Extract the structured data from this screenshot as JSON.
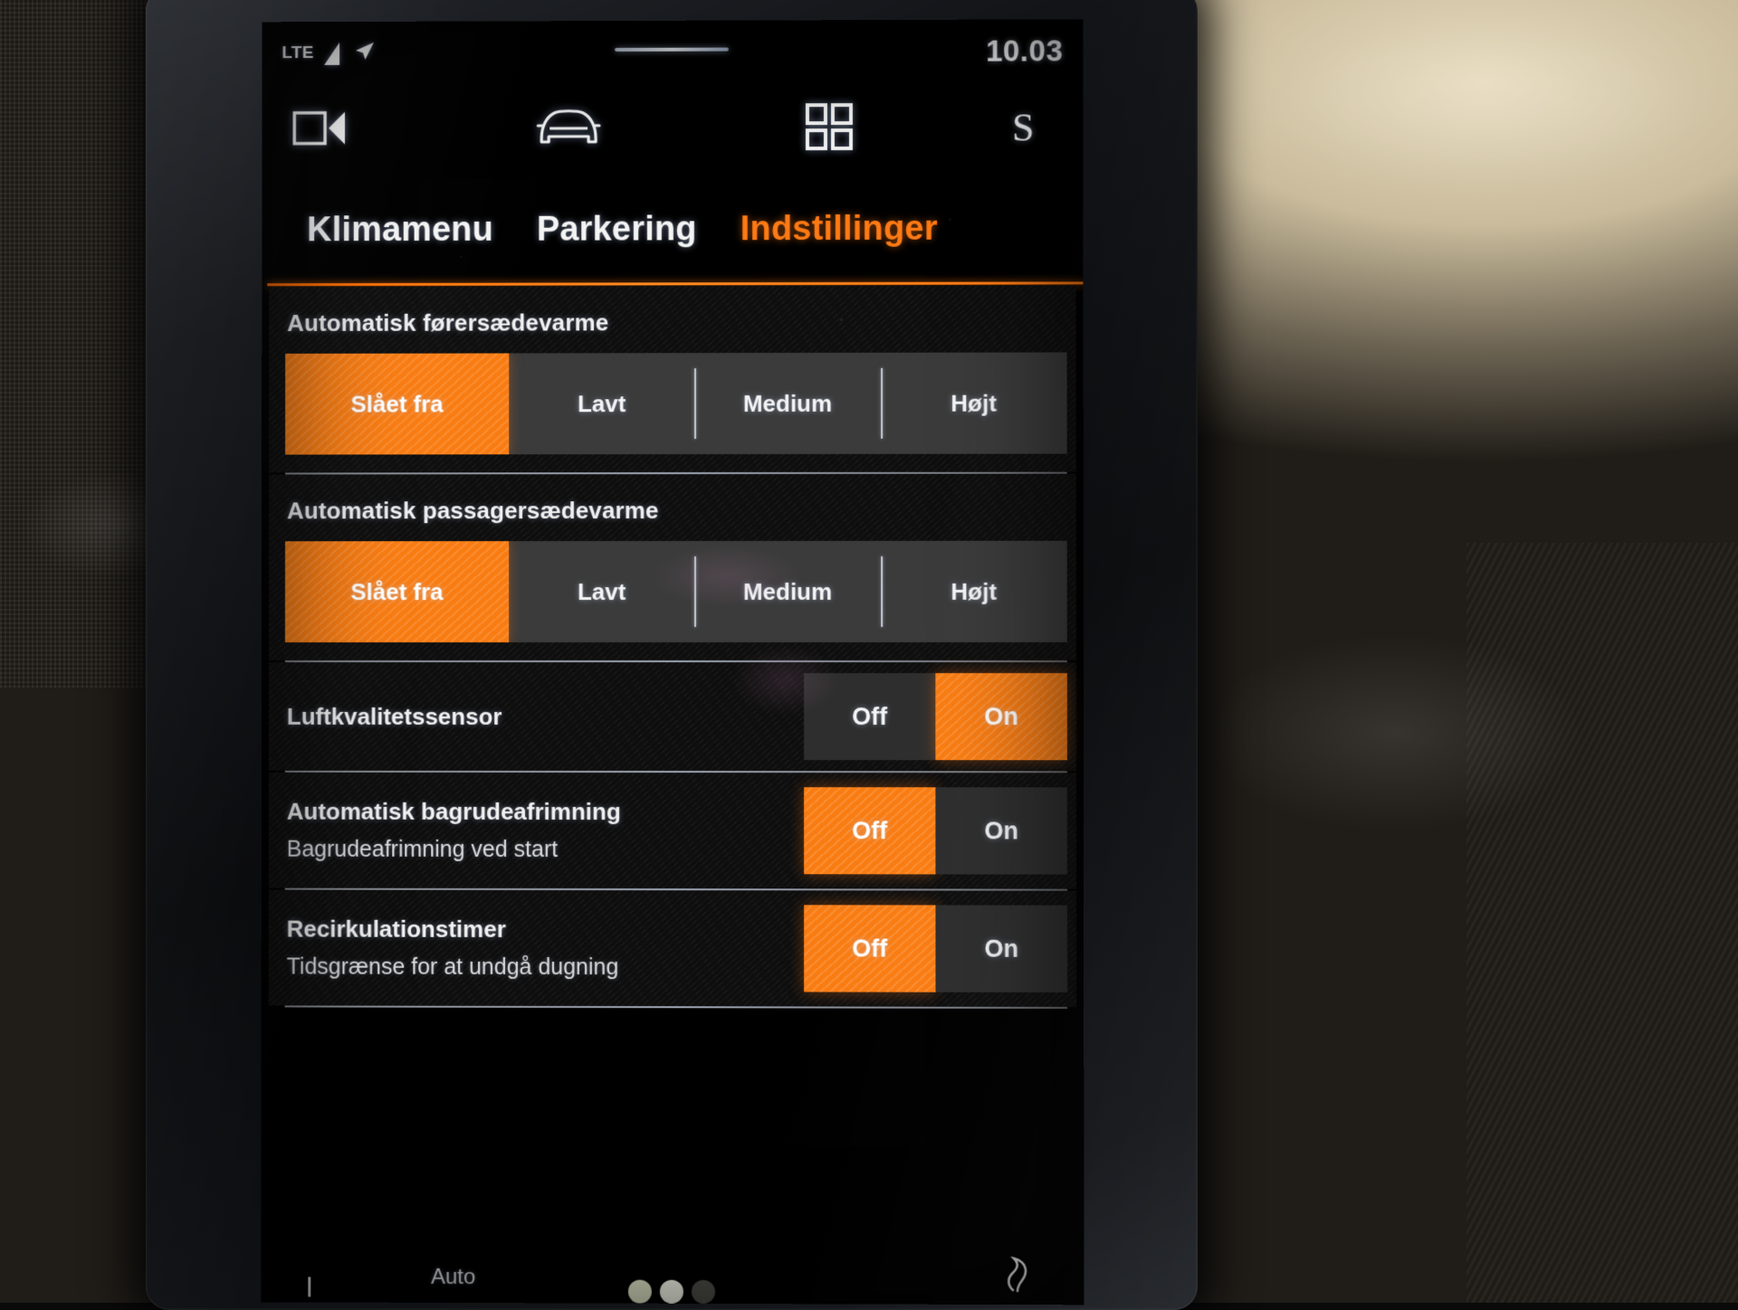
{
  "status_bar": {
    "network": "LTE",
    "signal_icon": "signal-bars-icon",
    "location_icon": "navigation-arrow-icon",
    "time": "10.03"
  },
  "icon_bar": {
    "camera_icon": "camera-view-icon",
    "car_icon": "car-front-icon",
    "apps_icon": "apps-grid-icon",
    "profile": "S"
  },
  "tabs": [
    {
      "label": "Klimamenu",
      "active": false
    },
    {
      "label": "Parkering",
      "active": false
    },
    {
      "label": "Indstillinger",
      "active": true
    }
  ],
  "colors": {
    "accent": "#f97c12",
    "accent_text": "#ff7a14",
    "screen_bg": "#000000",
    "segment_bg": "#3b3b3b",
    "toggle_bg": "#2e2e2e"
  },
  "settings": {
    "driver_seat_heat": {
      "label": "Automatisk førersædevarme",
      "options": [
        "Slået fra",
        "Lavt",
        "Medium",
        "Højt"
      ],
      "selected": "Slået fra"
    },
    "passenger_seat_heat": {
      "label": "Automatisk passagersædevarme",
      "options": [
        "Slået fra",
        "Lavt",
        "Medium",
        "Højt"
      ],
      "selected": "Slået fra"
    },
    "air_quality_sensor": {
      "label": "Luftkvalitetssensor",
      "subtitle": "",
      "options": [
        "Off",
        "On"
      ],
      "selected": "On"
    },
    "auto_rear_defrost": {
      "label": "Automatisk bagrudeafrimning",
      "subtitle": "Bagrudeafrimning ved start",
      "options": [
        "Off",
        "On"
      ],
      "selected": "Off"
    },
    "recirculation_timer": {
      "label": "Recirkulationstimer",
      "subtitle": "Tidsgrænse for at undgå dugning",
      "options": [
        "Off",
        "On"
      ],
      "selected": "Off"
    }
  },
  "bottom_bar": {
    "auto_label": "Auto",
    "fan_icon": "fan-icon"
  }
}
